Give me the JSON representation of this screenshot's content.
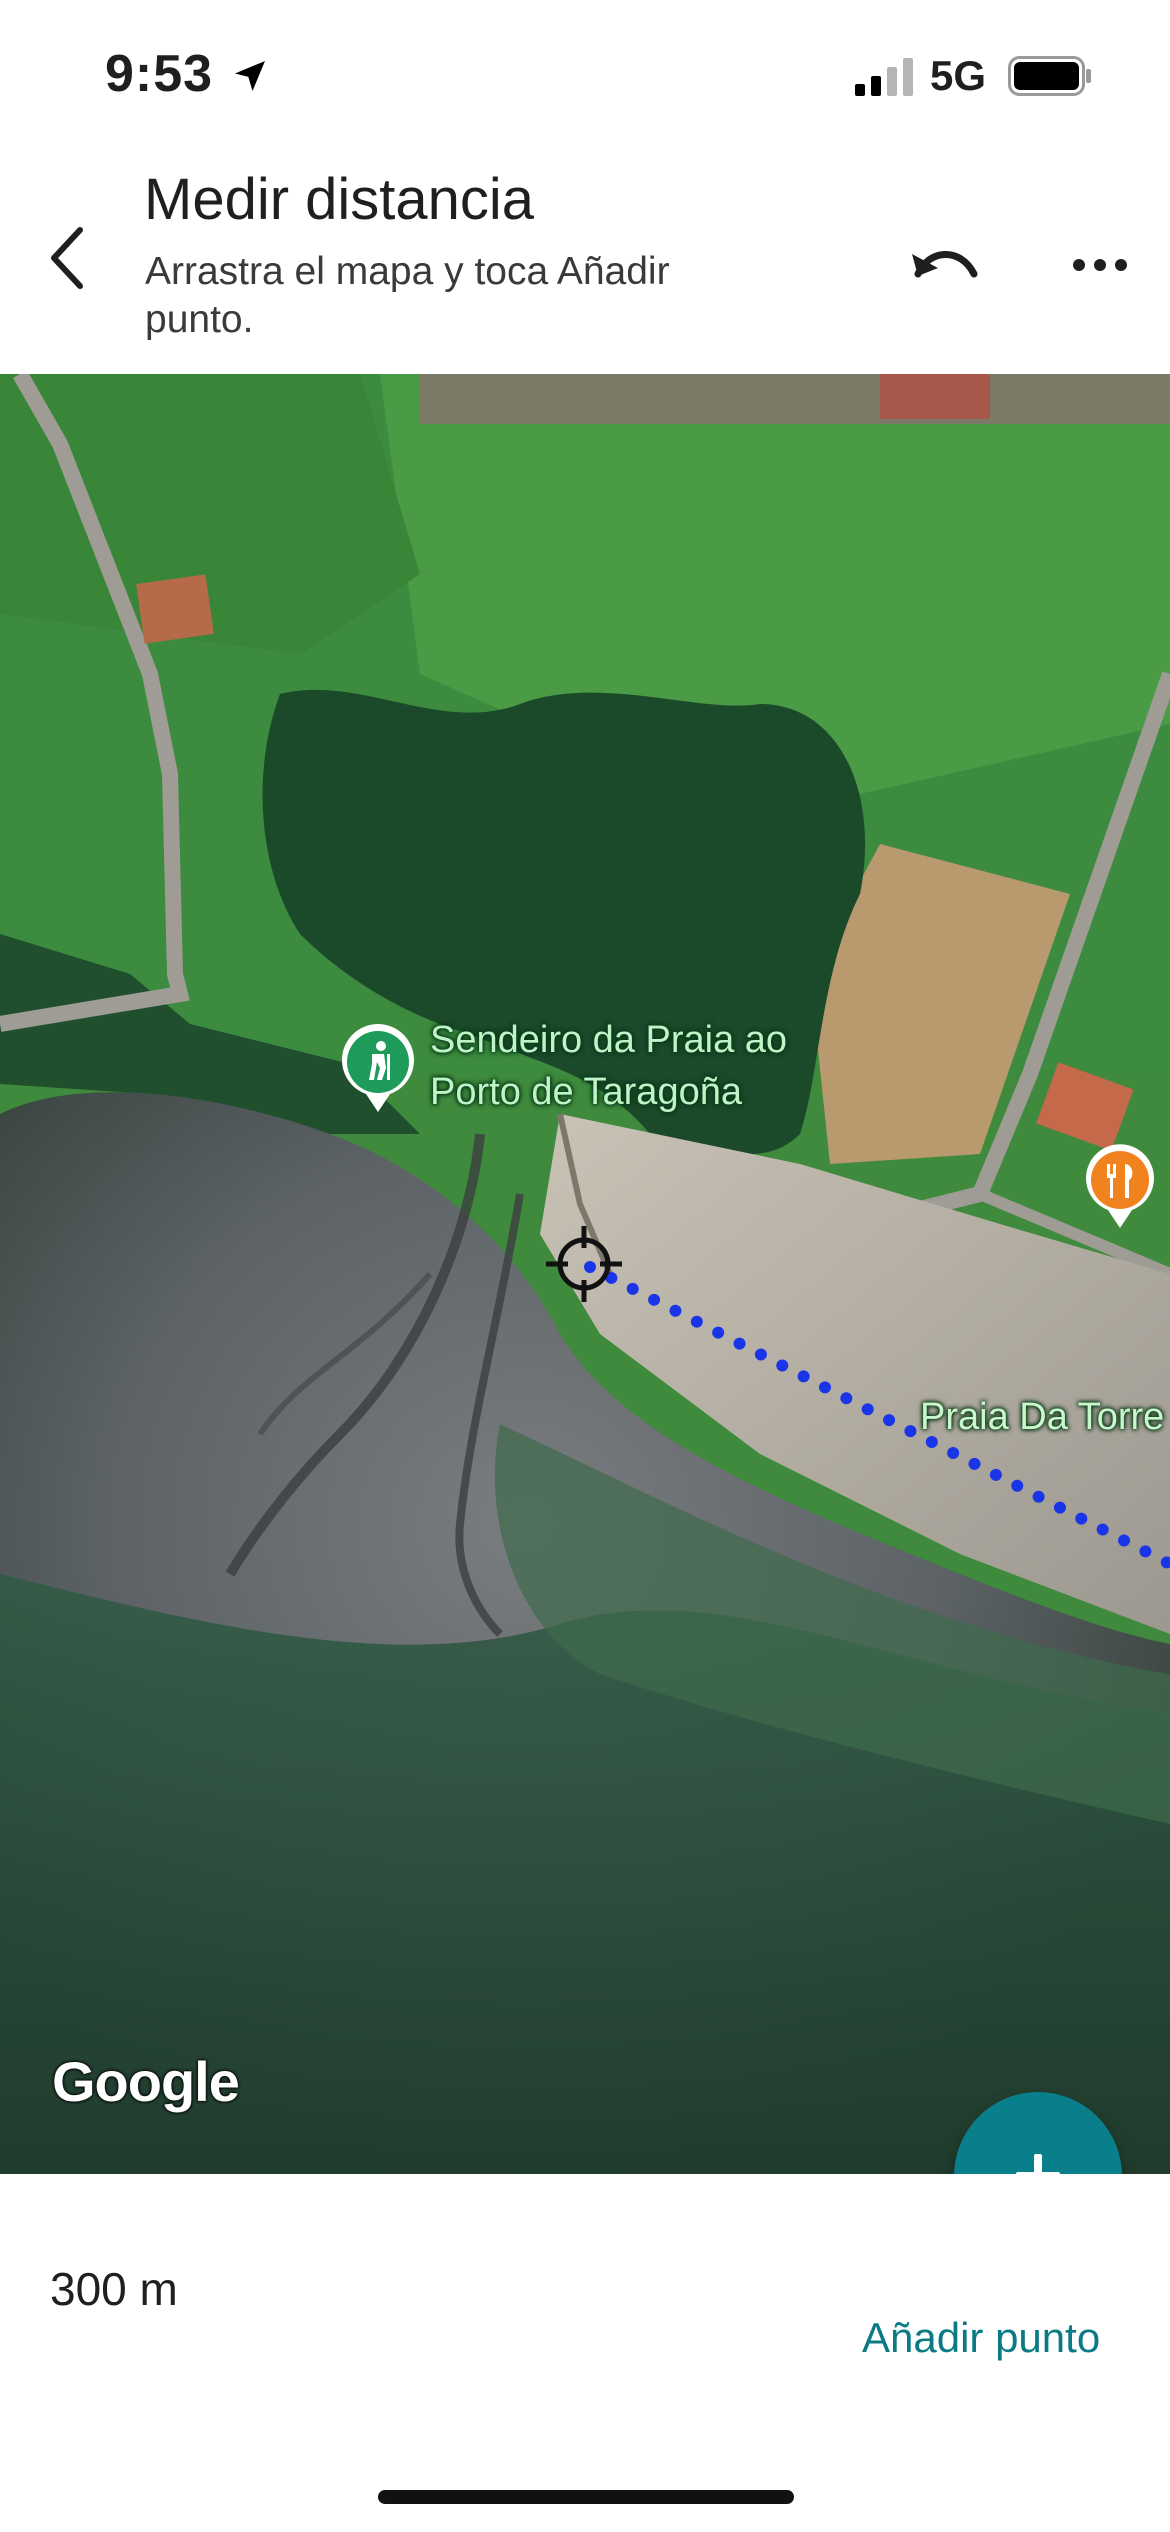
{
  "status_bar": {
    "time": "9:53",
    "network": "5G"
  },
  "header": {
    "title": "Medir distancia",
    "subtitle": "Arrastra el mapa y toca Añadir punto."
  },
  "map": {
    "poi": {
      "name": "Sendeiro da Praia ao Porto de Taragoña",
      "icon": "hiking-icon",
      "color": "#1e9b5a"
    },
    "restaurant": {
      "icon": "restaurant-icon",
      "color": "#f0831e"
    },
    "beach_label": "Praia Da Torre",
    "logo": "Google",
    "measure_line_color": "#1a35e8"
  },
  "bottom": {
    "distance": "300 m",
    "add_point_label": "Añadir punto",
    "accent": "#0a7f8c"
  }
}
